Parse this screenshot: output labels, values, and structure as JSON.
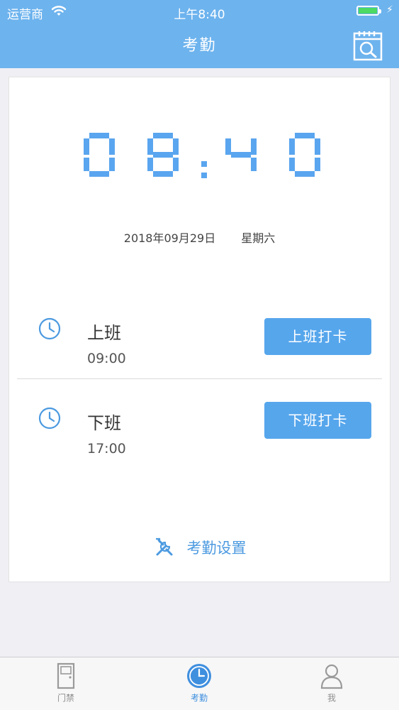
{
  "status_bar": {
    "carrier": "运营商",
    "time": "上午8:40"
  },
  "nav": {
    "title": "考勤"
  },
  "clock": {
    "hour": "08",
    "minute": "40"
  },
  "date": {
    "date_text": "2018年09月29日",
    "weekday": "星期六"
  },
  "shifts": [
    {
      "label": "上班",
      "time": "09:00",
      "button": "上班打卡"
    },
    {
      "label": "下班",
      "time": "17:00",
      "button": "下班打卡"
    }
  ],
  "settings_link": "考勤设置",
  "tabs": [
    {
      "label": "门禁",
      "icon": "door-icon"
    },
    {
      "label": "考勤",
      "icon": "clock-icon"
    },
    {
      "label": "我",
      "icon": "person-icon"
    }
  ],
  "colors": {
    "accent": "#6db3ee",
    "button": "#56a6ec",
    "digit": "#5aa5ef"
  }
}
